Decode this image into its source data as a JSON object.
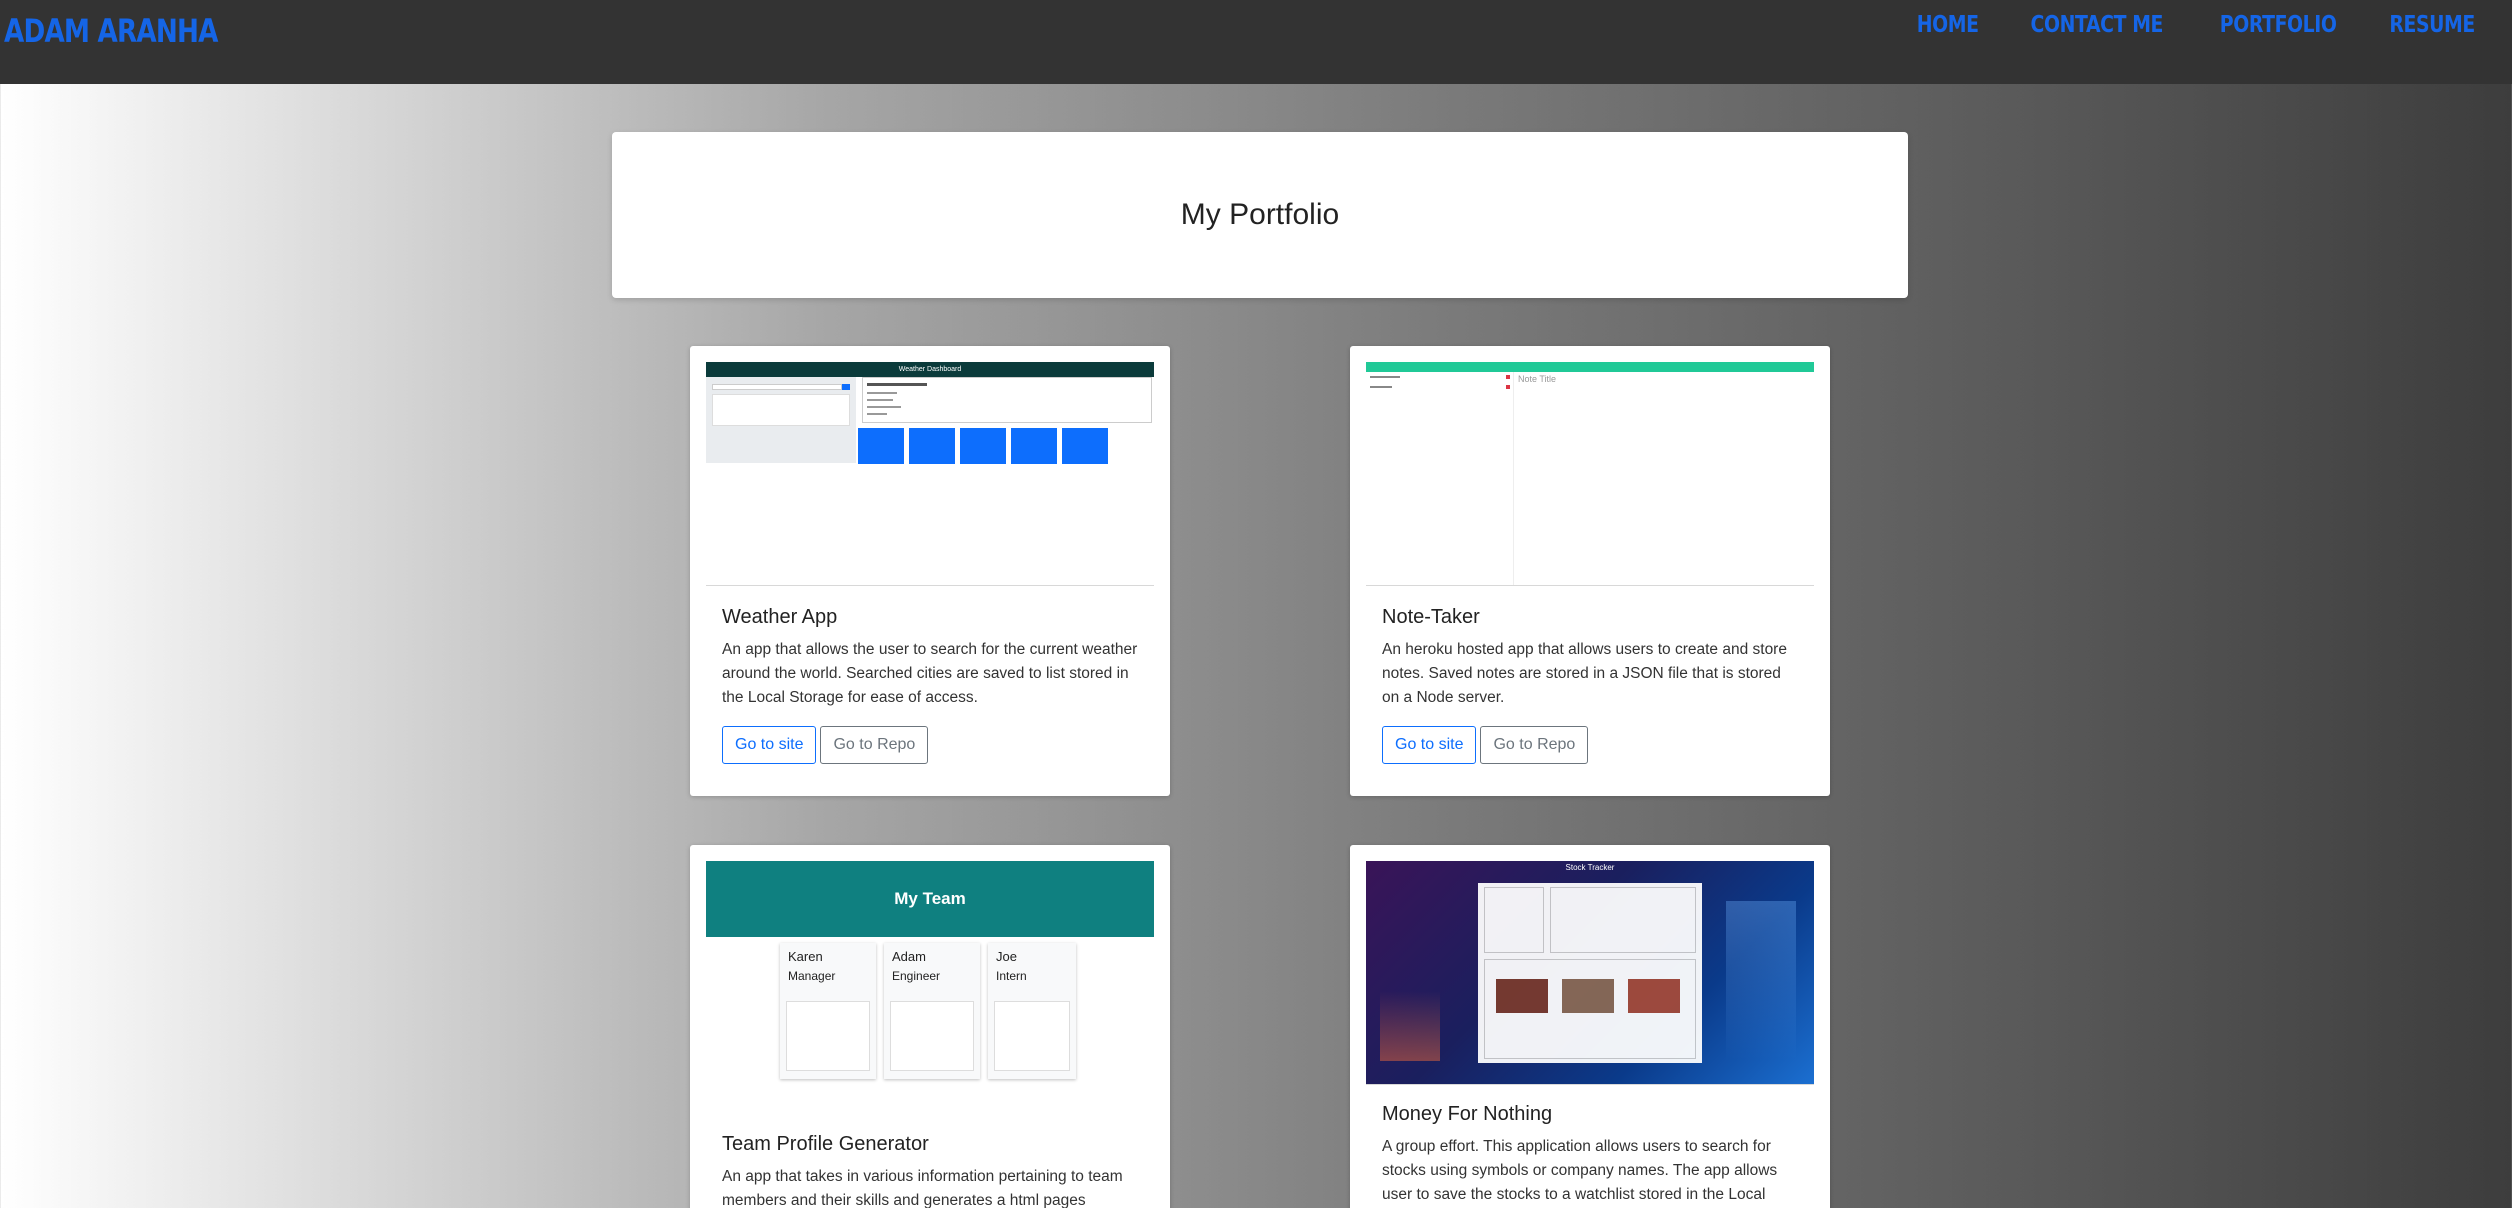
{
  "header": {
    "brand": "ADAM ARANHA",
    "nav": [
      "HOME",
      "CONTACT ME",
      "PORTFOLIO",
      "RESUME"
    ]
  },
  "page_title": "My Portfolio",
  "projects": [
    {
      "title": "Weather App",
      "description": "An app that allows the user to search for the current weather around the world. Searched cities are saved to list stored in the Local Storage for ease of access.",
      "site_label": "Go to site",
      "repo_label": "Go to Repo",
      "shot": {
        "header": "Weather Dashboard"
      }
    },
    {
      "title": "Note-Taker",
      "description": "An heroku hosted app that allows users to create and store notes. Saved notes are stored in a JSON file that is stored on a Node server.",
      "site_label": "Go to site",
      "repo_label": "Go to Repo",
      "shot": {
        "placeholder": "Note Title"
      }
    },
    {
      "title": "Team Profile Generator",
      "description": "An app that takes in various information pertaining to team members and their skills and generates a html pages",
      "shot": {
        "header": "My Team",
        "members": [
          {
            "name": "Karen",
            "role": "Manager"
          },
          {
            "name": "Adam",
            "role": "Engineer"
          },
          {
            "name": "Joe",
            "role": "Intern"
          }
        ]
      }
    },
    {
      "title": "Money For Nothing",
      "description": "A group effort. This application allows users to search for stocks using symbols or company names. The app allows user to save the stocks to a watchlist stored in the Local",
      "shot": {
        "header": "Stock Tracker"
      }
    }
  ],
  "colors": {
    "topbar": "#333333",
    "nav_link": "#1565e6",
    "weather_header": "#0b3b3b",
    "weather_tile": "#0d6efd",
    "note_header": "#20c997",
    "team_header": "#0f8080"
  }
}
